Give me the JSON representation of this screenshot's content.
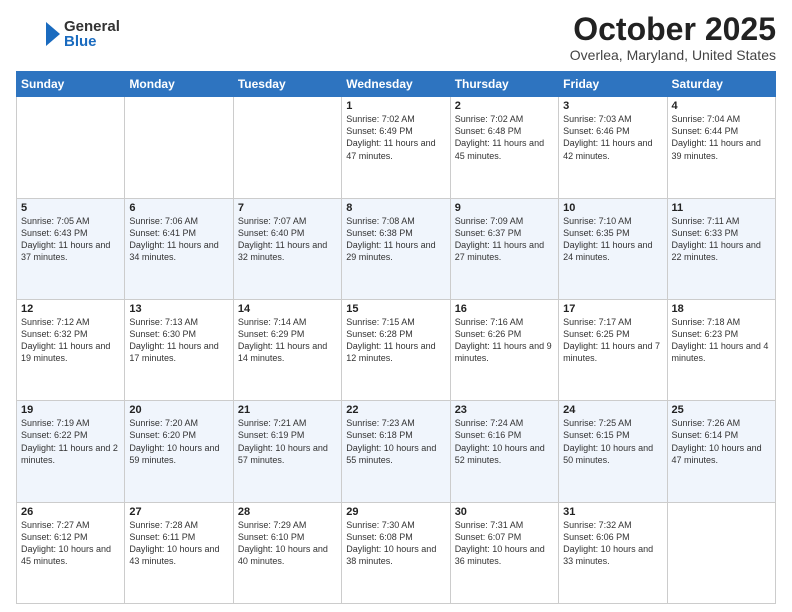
{
  "header": {
    "logo_general": "General",
    "logo_blue": "Blue",
    "month_title": "October 2025",
    "location": "Overlea, Maryland, United States"
  },
  "days_of_week": [
    "Sunday",
    "Monday",
    "Tuesday",
    "Wednesday",
    "Thursday",
    "Friday",
    "Saturday"
  ],
  "weeks": [
    [
      {
        "day": "",
        "info": ""
      },
      {
        "day": "",
        "info": ""
      },
      {
        "day": "",
        "info": ""
      },
      {
        "day": "1",
        "info": "Sunrise: 7:02 AM\nSunset: 6:49 PM\nDaylight: 11 hours and 47 minutes."
      },
      {
        "day": "2",
        "info": "Sunrise: 7:02 AM\nSunset: 6:48 PM\nDaylight: 11 hours and 45 minutes."
      },
      {
        "day": "3",
        "info": "Sunrise: 7:03 AM\nSunset: 6:46 PM\nDaylight: 11 hours and 42 minutes."
      },
      {
        "day": "4",
        "info": "Sunrise: 7:04 AM\nSunset: 6:44 PM\nDaylight: 11 hours and 39 minutes."
      }
    ],
    [
      {
        "day": "5",
        "info": "Sunrise: 7:05 AM\nSunset: 6:43 PM\nDaylight: 11 hours and 37 minutes."
      },
      {
        "day": "6",
        "info": "Sunrise: 7:06 AM\nSunset: 6:41 PM\nDaylight: 11 hours and 34 minutes."
      },
      {
        "day": "7",
        "info": "Sunrise: 7:07 AM\nSunset: 6:40 PM\nDaylight: 11 hours and 32 minutes."
      },
      {
        "day": "8",
        "info": "Sunrise: 7:08 AM\nSunset: 6:38 PM\nDaylight: 11 hours and 29 minutes."
      },
      {
        "day": "9",
        "info": "Sunrise: 7:09 AM\nSunset: 6:37 PM\nDaylight: 11 hours and 27 minutes."
      },
      {
        "day": "10",
        "info": "Sunrise: 7:10 AM\nSunset: 6:35 PM\nDaylight: 11 hours and 24 minutes."
      },
      {
        "day": "11",
        "info": "Sunrise: 7:11 AM\nSunset: 6:33 PM\nDaylight: 11 hours and 22 minutes."
      }
    ],
    [
      {
        "day": "12",
        "info": "Sunrise: 7:12 AM\nSunset: 6:32 PM\nDaylight: 11 hours and 19 minutes."
      },
      {
        "day": "13",
        "info": "Sunrise: 7:13 AM\nSunset: 6:30 PM\nDaylight: 11 hours and 17 minutes."
      },
      {
        "day": "14",
        "info": "Sunrise: 7:14 AM\nSunset: 6:29 PM\nDaylight: 11 hours and 14 minutes."
      },
      {
        "day": "15",
        "info": "Sunrise: 7:15 AM\nSunset: 6:28 PM\nDaylight: 11 hours and 12 minutes."
      },
      {
        "day": "16",
        "info": "Sunrise: 7:16 AM\nSunset: 6:26 PM\nDaylight: 11 hours and 9 minutes."
      },
      {
        "day": "17",
        "info": "Sunrise: 7:17 AM\nSunset: 6:25 PM\nDaylight: 11 hours and 7 minutes."
      },
      {
        "day": "18",
        "info": "Sunrise: 7:18 AM\nSunset: 6:23 PM\nDaylight: 11 hours and 4 minutes."
      }
    ],
    [
      {
        "day": "19",
        "info": "Sunrise: 7:19 AM\nSunset: 6:22 PM\nDaylight: 11 hours and 2 minutes."
      },
      {
        "day": "20",
        "info": "Sunrise: 7:20 AM\nSunset: 6:20 PM\nDaylight: 10 hours and 59 minutes."
      },
      {
        "day": "21",
        "info": "Sunrise: 7:21 AM\nSunset: 6:19 PM\nDaylight: 10 hours and 57 minutes."
      },
      {
        "day": "22",
        "info": "Sunrise: 7:23 AM\nSunset: 6:18 PM\nDaylight: 10 hours and 55 minutes."
      },
      {
        "day": "23",
        "info": "Sunrise: 7:24 AM\nSunset: 6:16 PM\nDaylight: 10 hours and 52 minutes."
      },
      {
        "day": "24",
        "info": "Sunrise: 7:25 AM\nSunset: 6:15 PM\nDaylight: 10 hours and 50 minutes."
      },
      {
        "day": "25",
        "info": "Sunrise: 7:26 AM\nSunset: 6:14 PM\nDaylight: 10 hours and 47 minutes."
      }
    ],
    [
      {
        "day": "26",
        "info": "Sunrise: 7:27 AM\nSunset: 6:12 PM\nDaylight: 10 hours and 45 minutes."
      },
      {
        "day": "27",
        "info": "Sunrise: 7:28 AM\nSunset: 6:11 PM\nDaylight: 10 hours and 43 minutes."
      },
      {
        "day": "28",
        "info": "Sunrise: 7:29 AM\nSunset: 6:10 PM\nDaylight: 10 hours and 40 minutes."
      },
      {
        "day": "29",
        "info": "Sunrise: 7:30 AM\nSunset: 6:08 PM\nDaylight: 10 hours and 38 minutes."
      },
      {
        "day": "30",
        "info": "Sunrise: 7:31 AM\nSunset: 6:07 PM\nDaylight: 10 hours and 36 minutes."
      },
      {
        "day": "31",
        "info": "Sunrise: 7:32 AM\nSunset: 6:06 PM\nDaylight: 10 hours and 33 minutes."
      },
      {
        "day": "",
        "info": ""
      }
    ]
  ]
}
